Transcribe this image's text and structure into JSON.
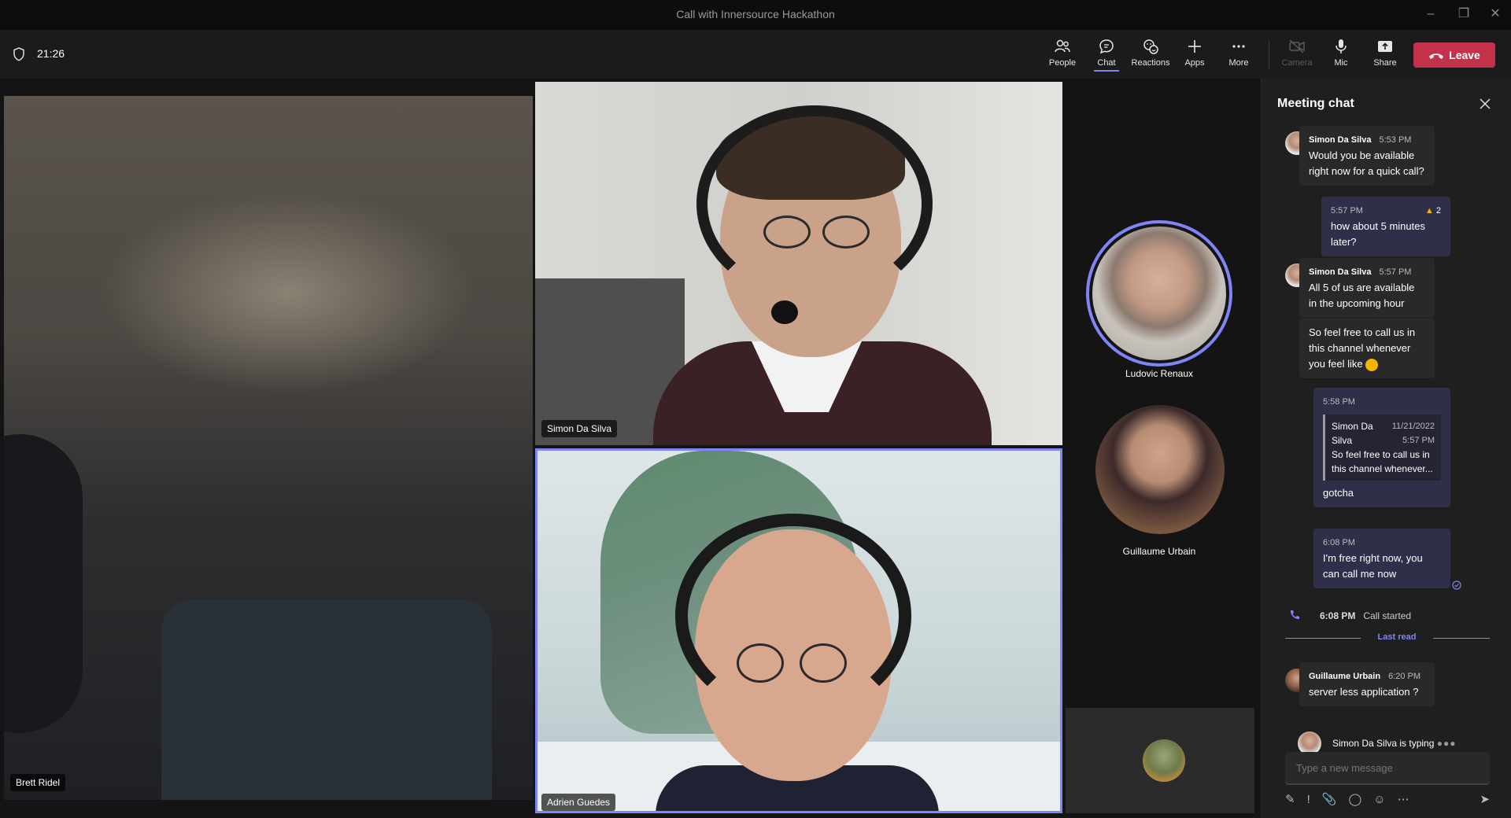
{
  "window": {
    "title": "Call with Innersource Hackathon"
  },
  "toolbar": {
    "timer": "21:26",
    "people": "People",
    "chat": "Chat",
    "reactions": "Reactions",
    "apps": "Apps",
    "more": "More",
    "camera": "Camera",
    "mic": "Mic",
    "share": "Share",
    "leave": "Leave"
  },
  "participants": {
    "left": "Brett Ridel",
    "top": "Simon Da Silva",
    "bottom": "Adrien Guedes",
    "side1": "Ludovic Renaux",
    "side2": "Guillaume Urbain"
  },
  "chat": {
    "title": "Meeting chat",
    "m1": {
      "author": "Simon Da Silva",
      "time": "5:53 PM",
      "text": "Would you be available right now for a quick call?"
    },
    "m2": {
      "time": "5:57 PM",
      "text": "how about 5 minutes later?",
      "reaction_count": "2"
    },
    "m3": {
      "author": "Simon Da Silva",
      "time": "5:57 PM",
      "text": "All 5 of us are available in the upcoming hour"
    },
    "m4": {
      "text": "So feel free to call us in this channel whenever you feel like"
    },
    "m5": {
      "time": "5:58 PM",
      "quote_author_1": "Simon Da",
      "quote_author_2": "Silva",
      "quote_date": "11/21/2022",
      "quote_time": "5:57 PM",
      "quote_text": "So feel free to call us in this channel whenever...",
      "text": "gotcha"
    },
    "m6": {
      "time": "6:08 PM",
      "text": "I'm free right now, you can call me now"
    },
    "call": {
      "time": "6:08 PM",
      "label": "Call started"
    },
    "last_read": "Last read",
    "m7": {
      "author": "Guillaume Urbain",
      "time": "6:20 PM",
      "text": "server less application ?"
    },
    "typing": "Simon Da Silva is typing",
    "input_placeholder": "Type a new message"
  },
  "colors": {
    "accent": "#7f85f5",
    "leave": "#c4314b",
    "bubble_out": "#2f2f4a"
  }
}
